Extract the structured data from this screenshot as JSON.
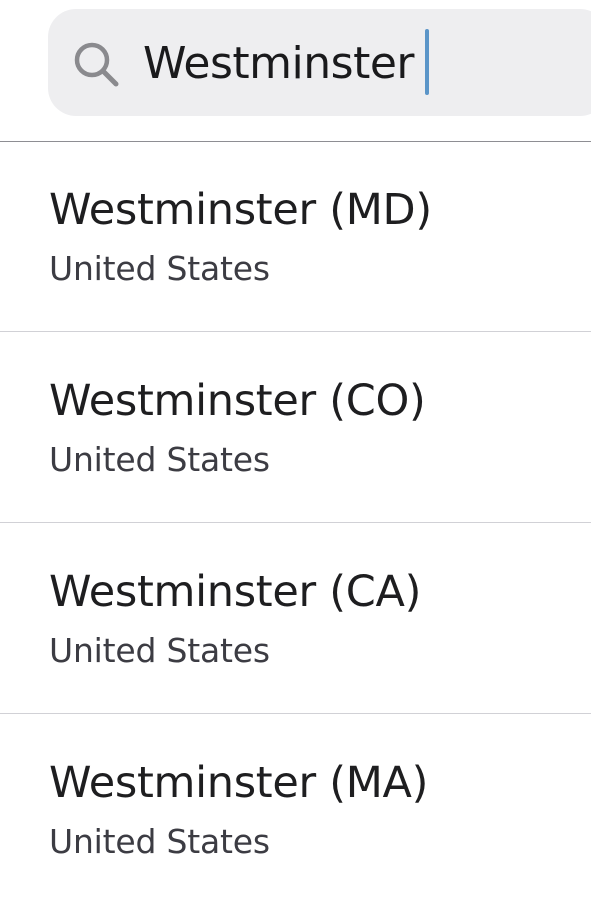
{
  "search": {
    "value": "Westminster",
    "icon": "search-icon"
  },
  "results": [
    {
      "title": "Westminster (MD)",
      "subtitle": "United States"
    },
    {
      "title": "Westminster (CO)",
      "subtitle": "United States"
    },
    {
      "title": "Westminster (CA)",
      "subtitle": "United States"
    },
    {
      "title": "Westminster (MA)",
      "subtitle": "United States"
    }
  ],
  "colors": {
    "search_background": "#eeeef0",
    "caret": "#5b95c8",
    "divider": "#d1d1d6",
    "text_primary": "#1e1e20",
    "text_secondary": "#3c3c43"
  }
}
